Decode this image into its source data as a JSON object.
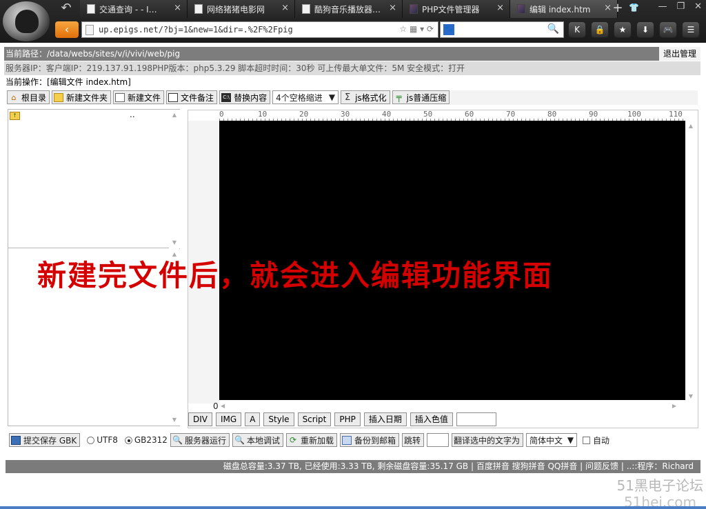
{
  "browser": {
    "tabs": [
      {
        "label": "交通查询 - - I…",
        "icon": "page-icon"
      },
      {
        "label": "网络猪猪电影网",
        "icon": "page-icon"
      },
      {
        "label": "酷狗音乐播放器…",
        "icon": "page-icon"
      },
      {
        "label": "PHP文件管理器",
        "icon": "avatar-icon"
      },
      {
        "label": "编辑 index.htm",
        "icon": "avatar-icon",
        "active": true
      }
    ],
    "close_glyph": "×",
    "new_tab_glyph": "+",
    "url": "up.epigs.net/?bj=1&new=1&dir=.%2F%2Fpig",
    "right_tools": [
      "K",
      "lock-icon",
      "star-icon",
      "download-icon",
      "gamepad-icon",
      "menu-icon"
    ],
    "right_tool_glyphs": [
      "K",
      "🔒",
      "★",
      "⬇",
      "🎮",
      "☰"
    ],
    "win_glyphs": [
      "—",
      "❐",
      "✕"
    ]
  },
  "header": {
    "path": "当前路径：/data/webs/sites/v/i/vivi/web/pig",
    "logout": "退出管理",
    "server_info": "服务器IP：客户端IP：219.137.91.198PHP版本：php5.3.29 脚本超时时间：30秒 可上传最大单文件：5M 安全模式：打开",
    "current_op": "当前操作：[编辑文件 index.htm]"
  },
  "toolbar": {
    "root": "根目录",
    "new_folder": "新建文件夹",
    "new_file": "新建文件",
    "file_note": "文件备注",
    "replace": "替换内容",
    "indent": "4个空格缩进",
    "js_format": "js格式化",
    "js_compress": "js普通压缩",
    "dropdown_glyph": "▼"
  },
  "file_panel": {
    "parent_dir": ".."
  },
  "editor": {
    "ruler_ticks": [
      "0",
      "10",
      "20",
      "30",
      "40",
      "50",
      "60",
      "70",
      "80",
      "90",
      "100",
      "110"
    ],
    "line_number": "0"
  },
  "tag_buttons": [
    "DIV",
    "IMG",
    "A",
    "Style",
    "Script",
    "PHP",
    "插入日期",
    "插入色值"
  ],
  "bottom": {
    "save": "提交保存 GBK",
    "utf8": "UTF8",
    "gb2312": "GB2312",
    "run_server": "服务器运行",
    "local_debug": "本地调试",
    "reload": "重新加载",
    "backup_mail": "备份到邮箱",
    "jump": "跳转",
    "translate": "翻译选中的文字为",
    "lang": "简体中文",
    "auto": "自动"
  },
  "footer": {
    "text": "磁盘总容量:3.37 TB, 已经使用:3.33 TB, 剩余磁盘容量:35.17 GB | 百度拼音 搜狗拼音 QQ拼音 | 问题反馈 | ..::程序：Richard"
  },
  "overlay": {
    "caption": "新建完文件后，就会进入编辑功能界面"
  },
  "watermark": {
    "line1": "51黑电子论坛",
    "line2": "51hei.com"
  },
  "colors": {
    "header_bar": "#7d7d7d",
    "code_bg": "#000000",
    "caption": "#d40000",
    "nav_accent": "#f08a1c"
  }
}
